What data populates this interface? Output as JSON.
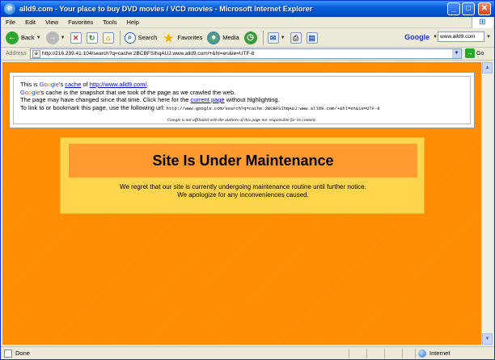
{
  "window": {
    "title": "alld9.com - Your place to buy DVD movies / VCD movies - Microsoft Internet Explorer"
  },
  "menu": [
    "File",
    "Edit",
    "View",
    "Favorites",
    "Tools",
    "Help"
  ],
  "toolbar": {
    "back": "Back",
    "search": "Search",
    "favorites": "Favorites",
    "media": "Media"
  },
  "google_toolbar": {
    "logo": "Google",
    "query": "www.alld9.com"
  },
  "address": {
    "label": "Address",
    "url": "http://216.239.41.104/search?q=cache:2BCBFSIhqAUJ:www.alld9.com/+&hl=en&ie=UTF-8",
    "go": "Go"
  },
  "cache_notice": {
    "l1_pre": "This is ",
    "l1_g": [
      "G",
      "o",
      "o",
      "g",
      "l",
      "e"
    ],
    "l1_mid": "'s ",
    "l1_cache": "cache",
    "l1_of": " of ",
    "l1_url": "http://www.alld9.com/",
    "l1_end": ".",
    "l2_g": [
      "G",
      "o",
      "o",
      "g",
      "l",
      "e"
    ],
    "l2_rest": "'s cache is the snapshot that we took of the page as we crawled the web.",
    "l3_pre": "The page may have changed since that time. Click here for the ",
    "l3_link": "current page",
    "l3_post": " without highlighting.",
    "l4_pre": "To link to or bookmark this page, use the following url: ",
    "l4_url": "http://www.google.com/search?q=cache:2BCBFSIhqAUJ:www.alld9.com/+&hl=en&ie=UTF-8",
    "disclaimer": "Google is not affiliated with the authors of this page nor responsible for its content."
  },
  "maintenance": {
    "title": "Site Is Under Maintenance",
    "line1": "We regret that our site is currently undergoing maintenance routine until further notice.",
    "line2": "We apologize for any inconveniences caused."
  },
  "status": {
    "text": "Done",
    "zone": "Internet"
  }
}
